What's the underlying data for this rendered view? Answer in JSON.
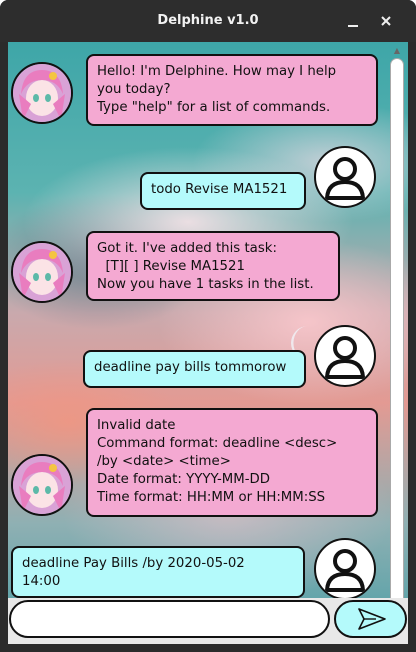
{
  "window": {
    "title": "Delphine v1.0",
    "minimize_glyph": "▁",
    "close_glyph": "✕"
  },
  "colors": {
    "bot_bubble": "#f4a9d2",
    "user_bubble": "#b4fafb",
    "titlebar": "#2d2d2d"
  },
  "messages": [
    {
      "sender": "bot",
      "text": "Hello! I'm Delphine. How may I help\nyou today?\nType \"help\" for a list of commands."
    },
    {
      "sender": "user",
      "text": "todo Revise MA1521"
    },
    {
      "sender": "bot",
      "text": "Got it. I've added this task:\n  [T][ ] Revise MA1521\nNow you have 1 tasks in the list."
    },
    {
      "sender": "user",
      "text": "deadline pay bills tommorow"
    },
    {
      "sender": "bot",
      "text": "Invalid date\nCommand format: deadline <desc>\n/by <date> <time>\nDate format: YYYY-MM-DD\nTime format: HH:MM or HH:MM:SS"
    },
    {
      "sender": "user",
      "text": "deadline Pay Bills /by 2020-05-02\n14:00"
    }
  ],
  "input": {
    "value": "",
    "placeholder": ""
  },
  "icons": {
    "bot_avatar": "anime-girl-avatar-icon",
    "user_avatar": "person-silhouette-icon",
    "send": "send-arrow-icon"
  }
}
